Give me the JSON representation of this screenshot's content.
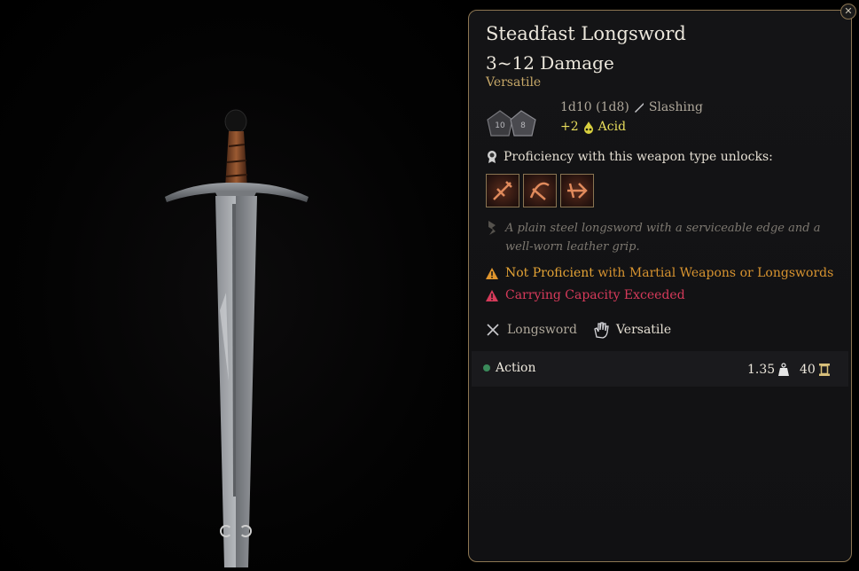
{
  "item": {
    "name": "Steadfast Longsword",
    "damage": "3~12 Damage",
    "tag": "Versatile",
    "damage_dice": "1d10 (1d8)",
    "damage_type": "Slashing",
    "bonus_amount": "+2",
    "bonus_type": "Acid",
    "dice_faces": [
      "10",
      "8"
    ]
  },
  "proficiency": {
    "label": "Proficiency with this weapon type unlocks:",
    "unlock_icons": [
      "action-icon-1",
      "action-icon-2",
      "action-icon-3"
    ]
  },
  "description": "A plain steel longsword with a serviceable edge and a well-worn leather grip.",
  "warnings": {
    "not_proficient_strong": "Not Proficient",
    "not_proficient_rest": " with Martial Weapons or Longswords",
    "capacity": "Carrying Capacity Exceeded"
  },
  "properties": {
    "weapon_type": "Longsword",
    "property": "Versatile"
  },
  "footer": {
    "action": "Action",
    "weight": "1.35",
    "value": "40"
  },
  "colors": {
    "accent": "#8d7652",
    "acid": "#e8dd5c",
    "warning": "#d7932f",
    "danger": "#d63a5a",
    "tag": "#c7a868"
  }
}
